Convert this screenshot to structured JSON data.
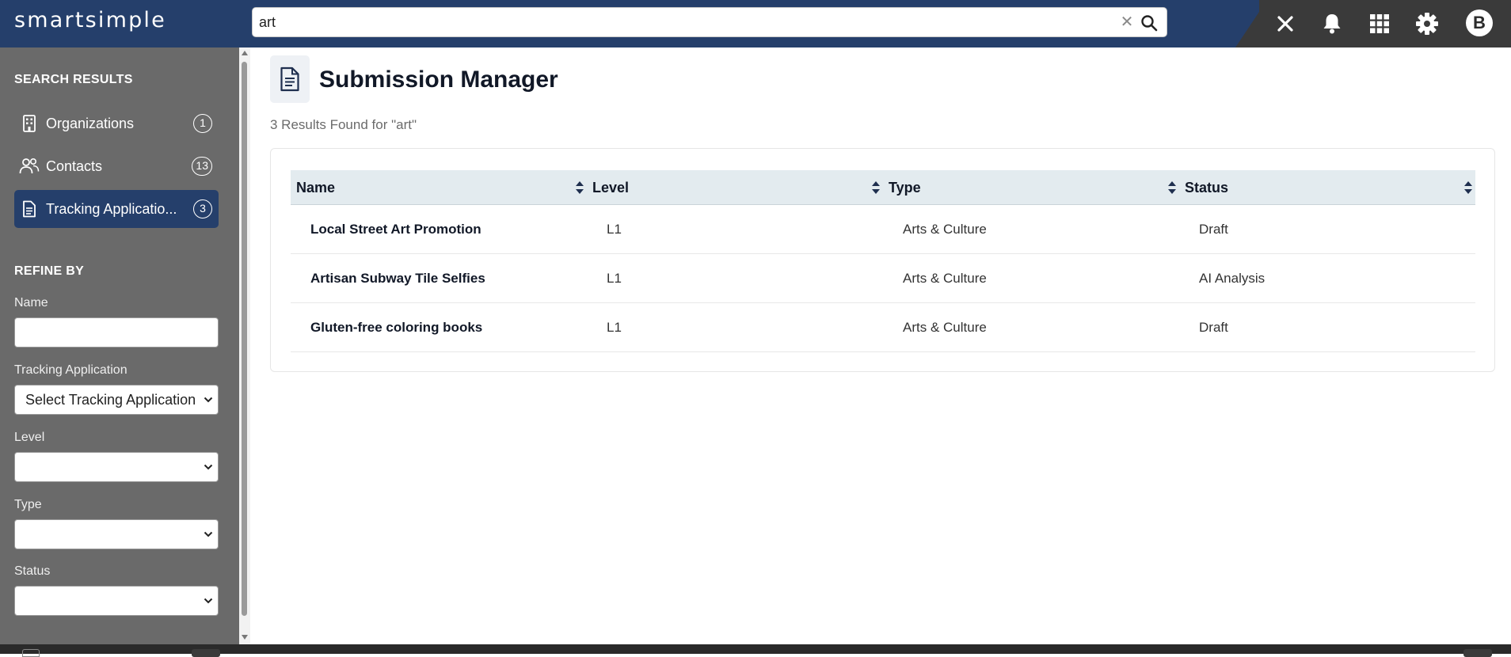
{
  "header": {
    "logo": "smartsimple",
    "search_value": "art",
    "clear_glyph": "✕",
    "avatar_initial": "B",
    "icons": [
      "close-icon",
      "bell-icon",
      "apps-grid-icon",
      "gear-icon"
    ]
  },
  "sidebar": {
    "search_results_heading": "SEARCH RESULTS",
    "items": [
      {
        "label": "Organizations",
        "count": "1",
        "icon": "building-icon"
      },
      {
        "label": "Contacts",
        "count": "13",
        "icon": "people-icon"
      },
      {
        "label": "Tracking Applicatio...",
        "count": "3",
        "icon": "document-icon",
        "active": true
      }
    ],
    "refine_heading": "REFINE BY",
    "filters": {
      "name_label": "Name",
      "name_value": "",
      "tracking_label": "Tracking Application",
      "tracking_value": "Select Tracking Application",
      "level_label": "Level",
      "level_value": "",
      "type_label": "Type",
      "type_value": "",
      "status_label": "Status",
      "status_value": ""
    }
  },
  "main": {
    "title": "Submission Manager",
    "results_text": "3 Results Found for \"art\"",
    "columns": [
      "Name",
      "Level",
      "Type",
      "Status"
    ],
    "rows": [
      {
        "name": "Local Street Art Promotion",
        "level": "L1",
        "type": "Arts & Culture",
        "status": "Draft"
      },
      {
        "name": "Artisan Subway Tile Selfies",
        "level": "L1",
        "type": "Arts & Culture",
        "status": "AI Analysis"
      },
      {
        "name": "Gluten-free coloring books",
        "level": "L1",
        "type": "Arts & Culture",
        "status": "Draft"
      }
    ]
  },
  "colors": {
    "brand_navy": "#253f6b",
    "topbar_dark": "#3a3a3a",
    "sidebar_gray": "#6a6a6a",
    "table_header_bg": "#e3ebef"
  }
}
